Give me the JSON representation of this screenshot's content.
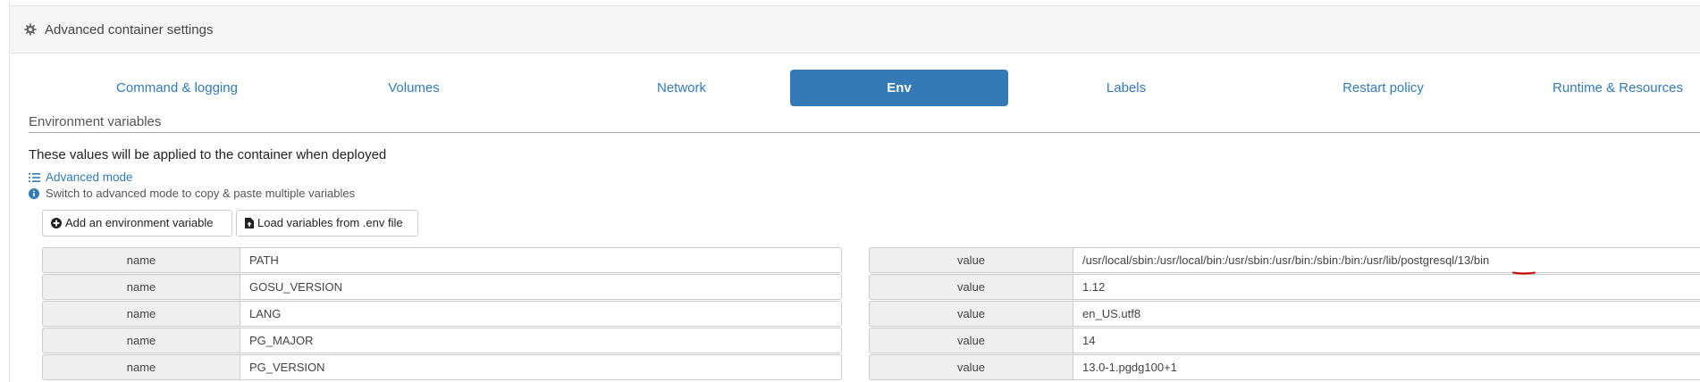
{
  "panel": {
    "title": "Advanced container settings",
    "icon": "gear-icon"
  },
  "tabs": [
    {
      "label": "Command & logging",
      "active": false
    },
    {
      "label": "Volumes",
      "active": false
    },
    {
      "label": "Network",
      "active": false
    },
    {
      "label": "Env",
      "active": true
    },
    {
      "label": "Labels",
      "active": false
    },
    {
      "label": "Restart policy",
      "active": false
    },
    {
      "label": "Runtime & Resources",
      "active": false
    }
  ],
  "env": {
    "section_title": "Environment variables",
    "applied_note": "These values will be applied to the container when deployed",
    "advanced_mode_label": "Advanced mode",
    "advanced_help": "Switch to advanced mode to copy & paste multiple variables",
    "add_button": "Add an environment variable",
    "load_button": "Load variables from .env file",
    "name_label": "name",
    "value_label": "value",
    "variables": [
      {
        "name": "PATH",
        "value": "/usr/local/sbin:/usr/local/bin:/usr/sbin:/usr/bin:/sbin:/bin:/usr/lib/postgresql/13/bin"
      },
      {
        "name": "GOSU_VERSION",
        "value": "1.12"
      },
      {
        "name": "LANG",
        "value": "en_US.utf8"
      },
      {
        "name": "PG_MAJOR",
        "value": "14"
      },
      {
        "name": "PG_VERSION",
        "value": "13.0-1.pgdg100+1"
      }
    ]
  },
  "colors": {
    "accent": "#337ab7",
    "annotation": "#cc0000"
  }
}
